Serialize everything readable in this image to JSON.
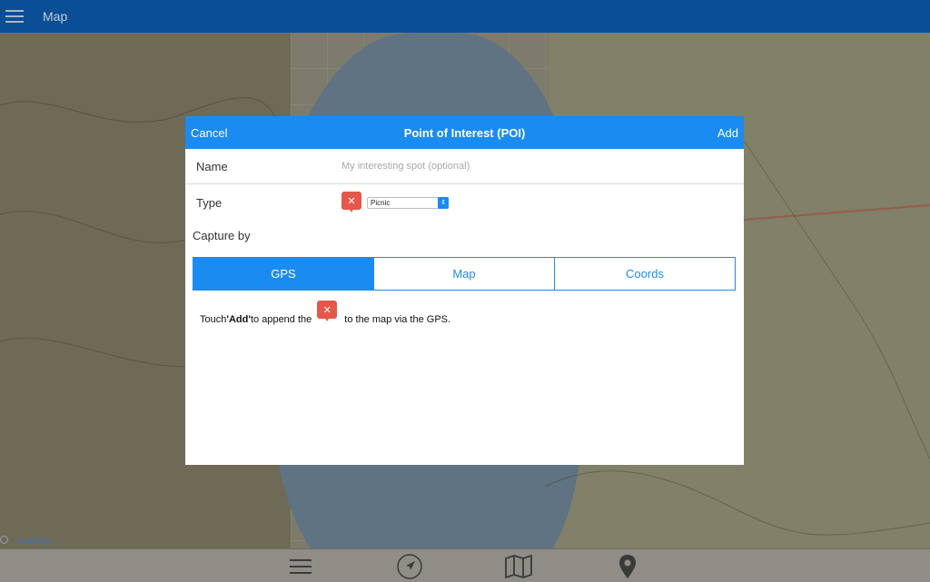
{
  "topbar": {
    "menu_icon": "hamburger-icon",
    "title": "Map"
  },
  "modal": {
    "cancel_label": "Cancel",
    "title": "Point of Interest (POI)",
    "add_label": "Add",
    "name_label": "Name",
    "name_value": "",
    "name_placeholder": "My interesting spot (optional)",
    "type_label": "Type",
    "type_icon": "picnic-poi-icon",
    "type_selected": "Picnic",
    "capture_label": "Capture by",
    "capture_tabs": [
      {
        "label": "GPS",
        "active": true
      },
      {
        "label": "Map",
        "active": false
      },
      {
        "label": "Coords",
        "active": false
      }
    ],
    "hint_prefix": "Touch ",
    "hint_bold": "'Add'",
    "hint_middle": "to append the",
    "hint_suffix": "to the map via the GPS."
  },
  "status": {
    "loading_text": "loading ..."
  },
  "bottombar": {
    "icons": [
      "menu-icon",
      "navigation-arrow-icon",
      "map-icon",
      "location-pin-icon"
    ]
  },
  "colors": {
    "topbar": "#0a4f96",
    "accent": "#1a8bf0",
    "poi_red": "#e4574a"
  }
}
